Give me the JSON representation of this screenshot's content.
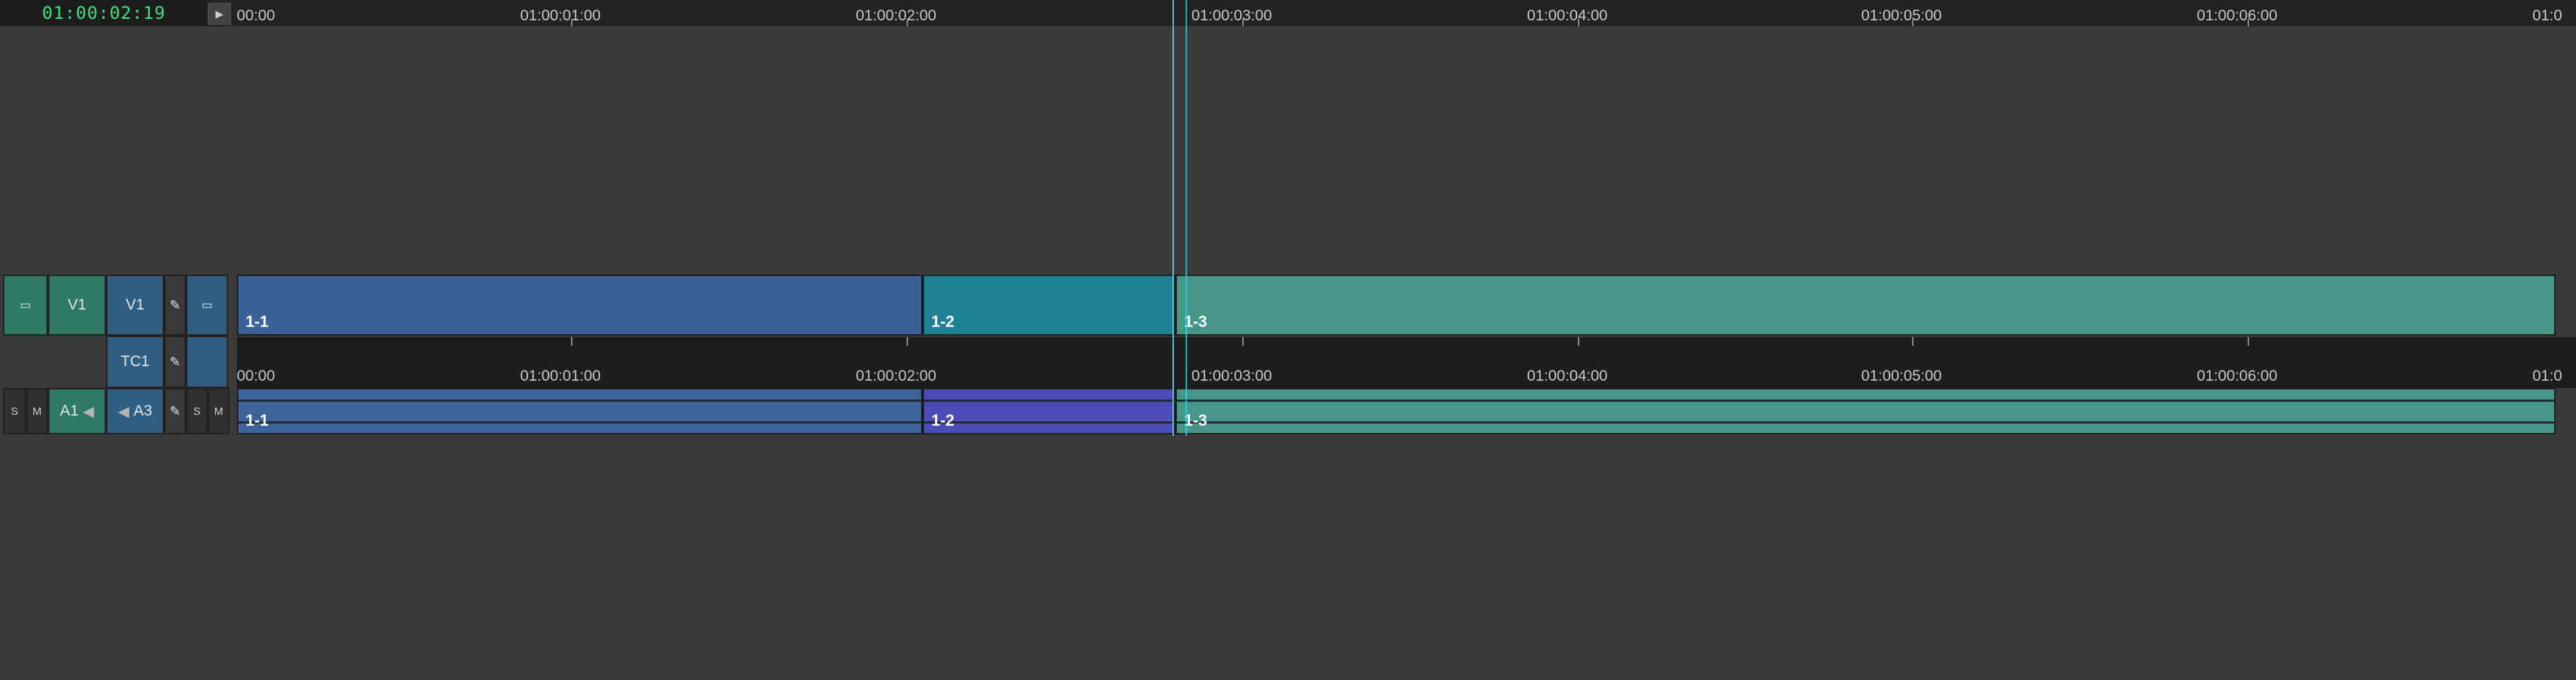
{
  "timecode": "01:00:02:19",
  "play_icon": "play-icon",
  "ruler_labels": [
    "00:00",
    "01:00:01:00",
    "01:00:02:00",
    "01:00:03:00",
    "01:00:04:00",
    "01:00:05:00",
    "01:00:06:00",
    "01:0"
  ],
  "tracks": {
    "video": {
      "source_label": "V1",
      "dest_label": "V1",
      "clips": [
        "1-1",
        "1-2",
        "1-3"
      ]
    },
    "timecode_track": {
      "label": "TC1"
    },
    "audio": {
      "solo": "S",
      "mute": "M",
      "source_label": "A1",
      "dest_label": "A3",
      "solo_right": "S",
      "mute_right": "M",
      "clips": [
        "1-1",
        "1-2",
        "1-3"
      ]
    }
  },
  "colors": {
    "timecode": "#3fe07f",
    "playhead": "#33d4e6",
    "clip_blue": "#3c6399",
    "clip_teal": "#1f7f94",
    "clip_green": "#46968a",
    "clip_violet": "#4d4bb8"
  }
}
